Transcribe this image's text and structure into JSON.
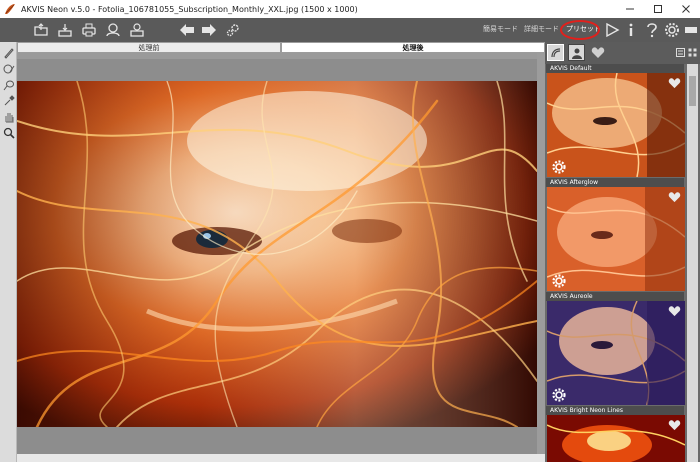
{
  "window": {
    "title": "AKVIS Neon v.5.0 - Fotolia_106781055_Subscription_Monthly_XXL.jpg (1500 x 1000)",
    "buttons": [
      "minimize-icon",
      "maximize-icon",
      "close-icon"
    ]
  },
  "toolbar": {
    "icons": [
      "open-icon",
      "save-icon",
      "print-icon",
      "share-icon",
      "export-icon",
      "undo-icon",
      "redo-icon",
      "settings-icon"
    ],
    "mode_simple": "簡易モード",
    "mode_advanced": "詳細モード",
    "presets": "プリセット",
    "right_icons": [
      "run-icon",
      "info-icon",
      "help-icon",
      "preferences-icon",
      "panel-icon"
    ],
    "highlight_color": "#e0201c"
  },
  "canvas": {
    "tab_before": "処理前",
    "tab_after": "処理後"
  },
  "left_tools": [
    "brush-icon",
    "history-brush-icon",
    "eraser-icon",
    "eyedropper-icon",
    "hand-icon",
    "zoom-icon"
  ],
  "right_panel": {
    "tabs": [
      "all-presets-icon",
      "user-presets-icon",
      "favorites-icon"
    ],
    "presets": [
      {
        "name": "AKVIS Default"
      },
      {
        "name": "AKVIS Afterglow"
      },
      {
        "name": "AKVIS Aureole"
      },
      {
        "name": "AKVIS Bright Neon Lines"
      }
    ]
  }
}
